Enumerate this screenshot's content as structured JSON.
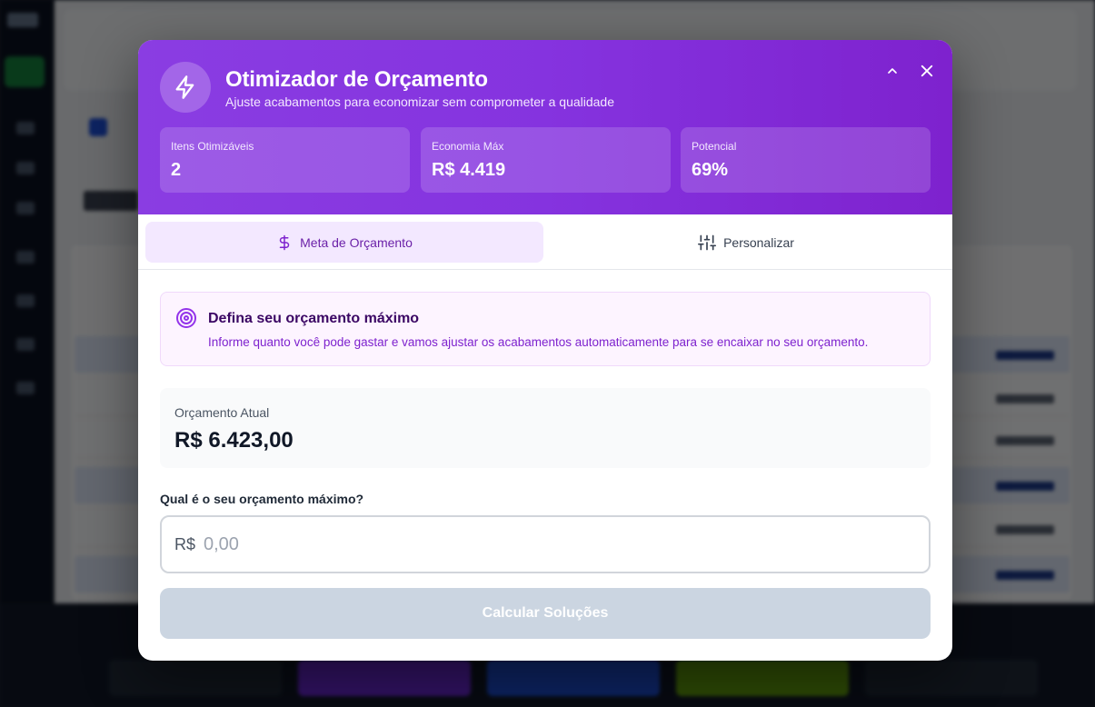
{
  "modal": {
    "title": "Otimizador de Orçamento",
    "subtitle": "Ajuste acabamentos para economizar sem comprometer a qualidade",
    "header_icon": "lightning-bolt-icon",
    "stats": [
      {
        "label": "Itens Otimizáveis",
        "value": "2"
      },
      {
        "label": "Economia Máx",
        "value": "R$ 4.419"
      },
      {
        "label": "Potencial",
        "value": "69%"
      }
    ],
    "accent_color": "#8b3de3"
  },
  "tabs": [
    {
      "label": "Meta de Orçamento",
      "icon": "dollar-sign-icon",
      "active": true
    },
    {
      "label": "Personalizar",
      "icon": "sliders-icon",
      "active": false
    }
  ],
  "info": {
    "title": "Defina seu orçamento máximo",
    "text": "Informe quanto você pode gastar e vamos ajustar os acabamentos automaticamente para se encaixar no seu orçamento.",
    "icon": "target-icon"
  },
  "current_budget": {
    "label": "Orçamento Atual",
    "value": "R$ 6.423,00"
  },
  "max_budget_input": {
    "label": "Qual é o seu orçamento máximo?",
    "prefix": "R$",
    "value": "",
    "placeholder": "0,00"
  },
  "calculate_button": {
    "label": "Calcular Soluções"
  }
}
